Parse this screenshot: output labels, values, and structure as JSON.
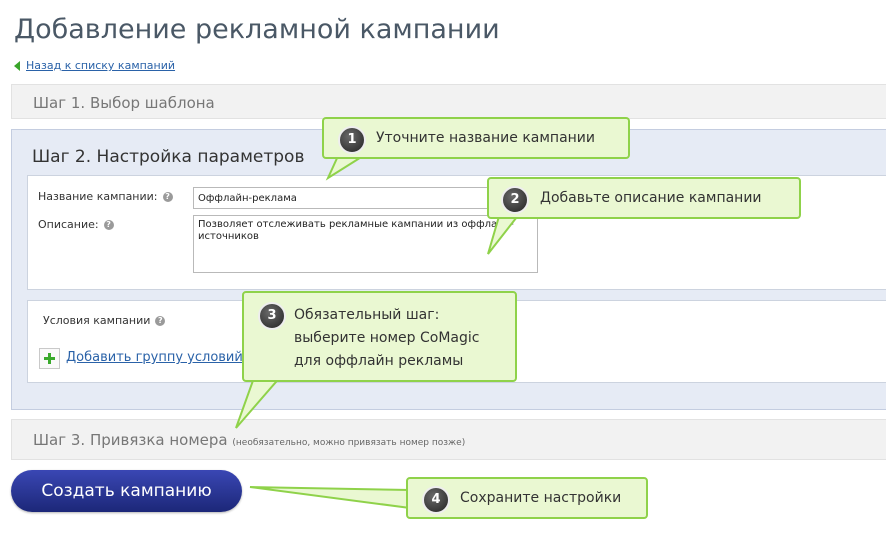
{
  "page": {
    "title": "Добавление рекламной кампании",
    "back_link": "Назад к списку кампаний"
  },
  "step1": {
    "label": "Шаг 1. Выбор шаблона"
  },
  "step2": {
    "label": "Шаг 2. Настройка параметров",
    "name_label": "Название кампании:",
    "name_value": "Оффлайн-реклама",
    "description_label": "Описание:",
    "description_value": "Позволяет отслеживать рекламные кампании из оффлайн-источников",
    "conditions_label": "Условия кампании",
    "add_group_link": "Добавить группу условий"
  },
  "step3": {
    "label": "Шаг 3. Привязка номера",
    "note": "(необязательно, можно привязать номер позже)"
  },
  "create_button": "Создать кампанию",
  "help_icon_glyph": "?",
  "callouts": [
    {
      "number": "1",
      "text": "Уточните название кампании"
    },
    {
      "number": "2",
      "text": "Добавьте описание кампании"
    },
    {
      "number": "3",
      "lines": [
        "Обязательный шаг:",
        "выберите номер CoMagic",
        "для оффлайн рекламы"
      ]
    },
    {
      "number": "4",
      "text": "Сохраните настройки"
    }
  ],
  "colors": {
    "link": "#2a62a8",
    "accent_green": "#3aa52a",
    "callout_bg": "#eaf8d2",
    "callout_border": "#8fd24a",
    "button": "#2b36a0",
    "step2_bg": "#e6ebf5"
  }
}
